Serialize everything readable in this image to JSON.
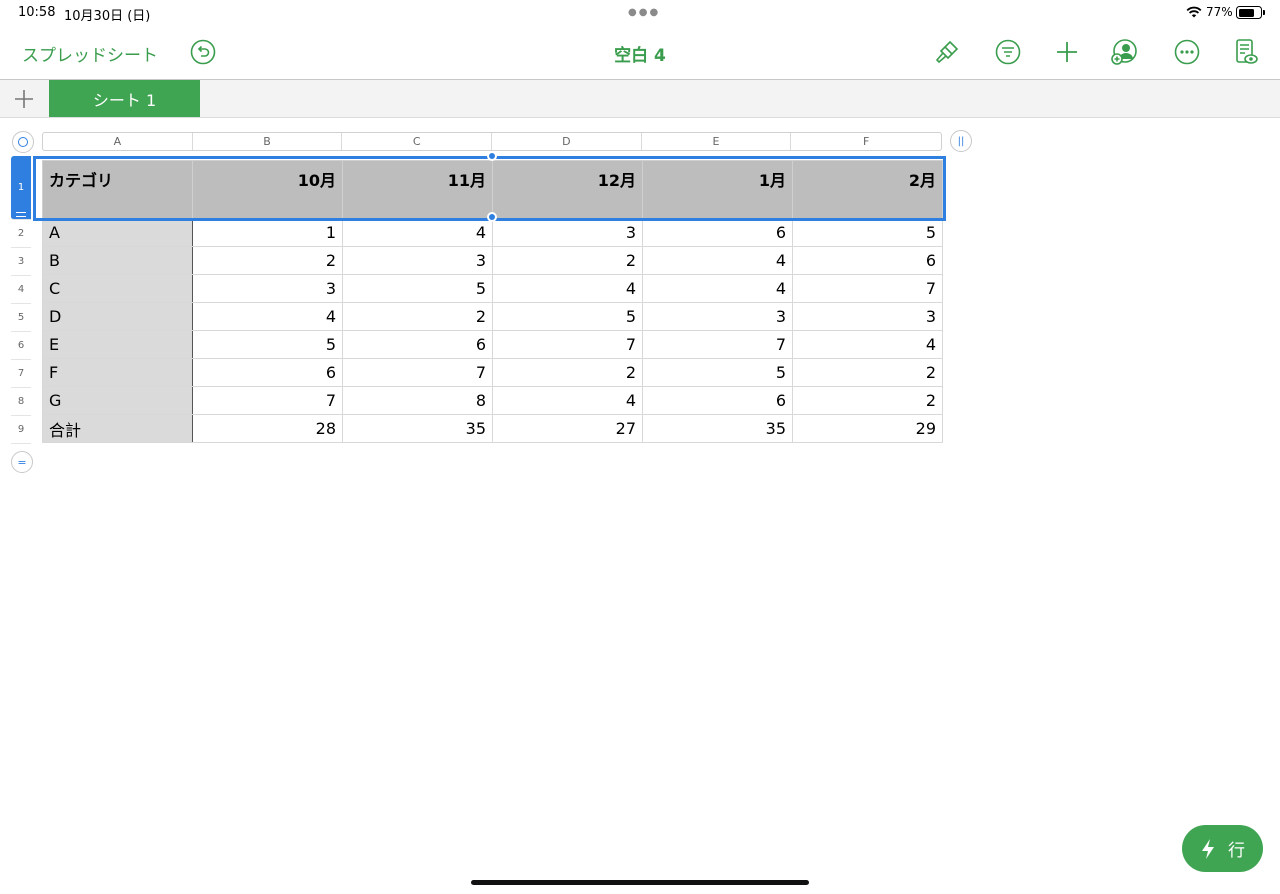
{
  "status_bar": {
    "time": "10:58",
    "date": "10月30日 (日)",
    "battery_pct": "77%",
    "battery_level": 0.77
  },
  "toolbar": {
    "back_label": "スプレッドシート",
    "title": "空白 4",
    "icons": [
      "undo-icon",
      "paintbrush-icon",
      "filter-icon",
      "plus-icon",
      "collaborate-icon",
      "more-icon",
      "document-view-icon"
    ]
  },
  "tabs": {
    "add_icon": "plus-icon",
    "sheet_name": "シート 1"
  },
  "sheet": {
    "column_letters": [
      "A",
      "B",
      "C",
      "D",
      "E",
      "F"
    ],
    "row_numbers": [
      "1",
      "2",
      "3",
      "4",
      "5",
      "6",
      "7",
      "8",
      "9"
    ],
    "header": [
      "カテゴリ",
      "10月",
      "11月",
      "12月",
      "1月",
      "2月"
    ],
    "rows": [
      [
        "A",
        "1",
        "4",
        "3",
        "6",
        "5"
      ],
      [
        "B",
        "2",
        "3",
        "2",
        "4",
        "6"
      ],
      [
        "C",
        "3",
        "5",
        "4",
        "4",
        "7"
      ],
      [
        "D",
        "4",
        "2",
        "5",
        "3",
        "3"
      ],
      [
        "E",
        "5",
        "6",
        "7",
        "7",
        "4"
      ],
      [
        "F",
        "6",
        "7",
        "2",
        "5",
        "2"
      ],
      [
        "G",
        "7",
        "8",
        "4",
        "6",
        "2"
      ],
      [
        "合計",
        "28",
        "35",
        "27",
        "35",
        "29"
      ]
    ]
  },
  "action_button": {
    "label": "行",
    "icon": "lightning-icon"
  },
  "colors": {
    "accent_green": "#3a9d4d",
    "selection_blue": "#2f7fe0"
  }
}
